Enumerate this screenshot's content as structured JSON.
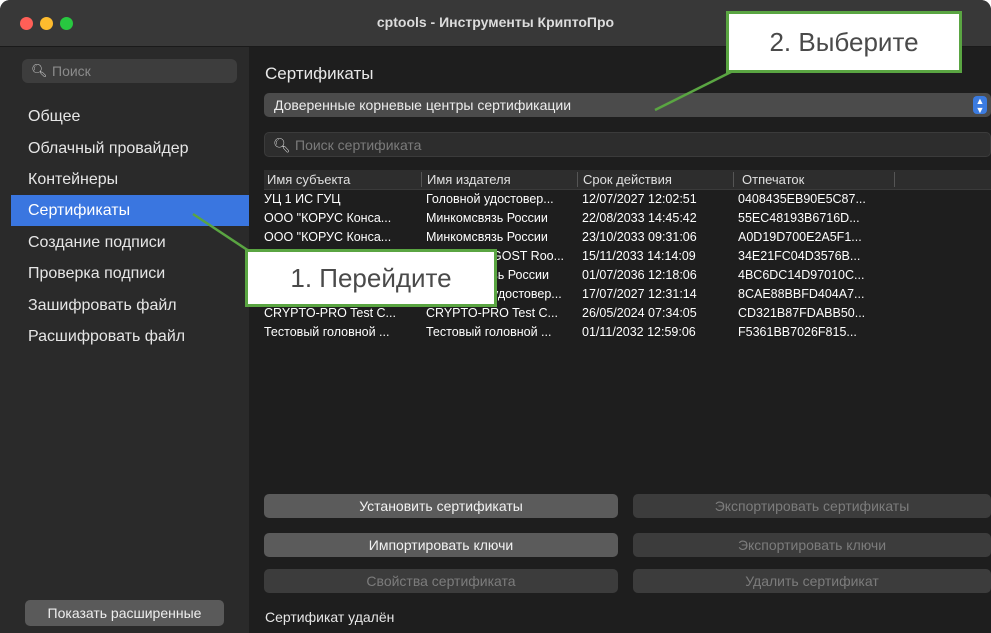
{
  "window": {
    "title": "cptools - Инструменты КриптоПро"
  },
  "sidebar": {
    "search_placeholder": "Поиск",
    "items": [
      {
        "label": "Общее"
      },
      {
        "label": "Облачный провайдер"
      },
      {
        "label": "Контейнеры"
      },
      {
        "label": "Сертификаты"
      },
      {
        "label": "Создание подписи"
      },
      {
        "label": "Проверка подписи"
      },
      {
        "label": "Зашифровать файл"
      },
      {
        "label": "Расшифровать файл"
      }
    ],
    "active_index": 3,
    "advanced_button": "Показать расширенные"
  },
  "main": {
    "title": "Сертификаты",
    "store_select": "Доверенные корневые центры сертификации",
    "search_placeholder": "Поиск сертификата",
    "columns": [
      "Имя субъекта",
      "Имя издателя",
      "Срок действия",
      "Отпечаток"
    ],
    "rows": [
      [
        "УЦ 1 ИС ГУЦ",
        "Головной удостовер...",
        "12/07/2027 12:02:51",
        "0408435EB90E5C87..."
      ],
      [
        "ООО \"КОРУС Конса...",
        "Минкомсвязь России",
        "22/08/2033 14:45:42",
        "55EC48193B6716D..."
      ],
      [
        "ООО \"КОРУС Конса...",
        "Минкомсвязь России",
        "23/10/2033 09:31:06",
        "A0D19D700E2A5F1..."
      ],
      [
        "",
        "GOST Roo...",
        "15/11/2033 14:14:09",
        "34E21FC04D3576B..."
      ],
      [
        "",
        "зь России",
        "01/07/2036 12:18:06",
        "4BC6DC14D97010C..."
      ],
      [
        "",
        "удостовер...",
        "17/07/2027 12:31:14",
        "8CAE88BBFD404A7..."
      ],
      [
        "CRYPTO-PRO Test C...",
        "CRYPTO-PRO Test C...",
        "26/05/2024 07:34:05",
        "CD321B87FDABB50..."
      ],
      [
        "Тестовый головной ...",
        "Тестовый головной ...",
        "01/11/2032 12:59:06",
        "F5361BB7026F815..."
      ]
    ],
    "buttons": {
      "install": "Установить сертификаты",
      "export_certs": "Экспортировать сертификаты",
      "import_keys": "Импортировать ключи",
      "export_keys": "Экспортировать ключи",
      "properties": "Свойства сертификата",
      "delete": "Удалить сертификат"
    },
    "status": "Сертификат удалён"
  },
  "callouts": {
    "step1": "1. Перейдите",
    "step2": "2. Выберите"
  },
  "colors": {
    "accent": "#3a76e0",
    "callout_border": "#5aa542"
  }
}
